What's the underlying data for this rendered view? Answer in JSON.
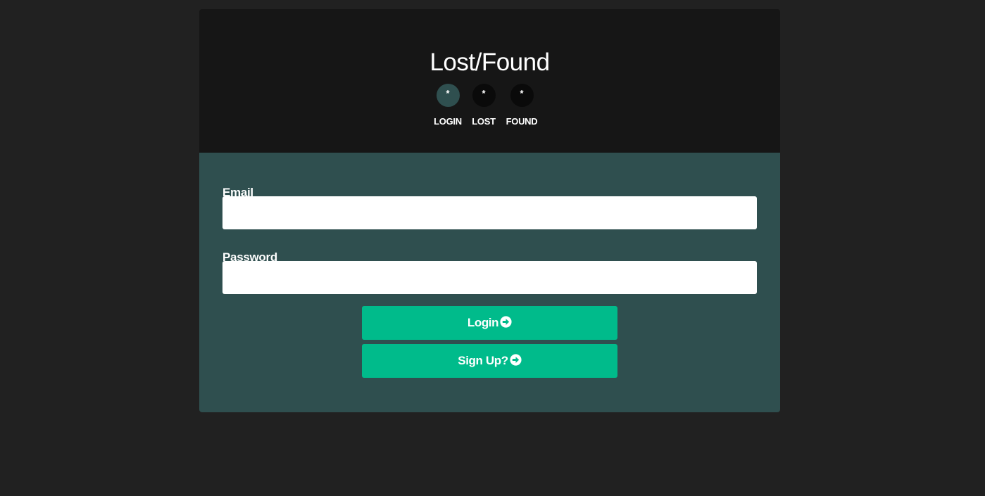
{
  "header": {
    "title": "Lost/Found",
    "steps": [
      {
        "symbol": "*",
        "label": "LOGIN",
        "active": true
      },
      {
        "symbol": "*",
        "label": "LOST",
        "active": false
      },
      {
        "symbol": "*",
        "label": "FOUND",
        "active": false
      }
    ]
  },
  "form": {
    "email_label": "Email",
    "email_value": "",
    "email_placeholder": "",
    "password_label": "Password",
    "password_value": "",
    "password_placeholder": "",
    "login_button": "Login",
    "signup_button": "Sign Up?",
    "button_icon": "arrow-circle-right-icon"
  },
  "colors": {
    "page_background": "#212121",
    "header_background": "#161616",
    "body_background": "#2f4f4f",
    "active_step": "#2f4f4f",
    "inactive_step": "#0a0a0a",
    "button": "#00bb8b",
    "text": "#ffffff"
  }
}
